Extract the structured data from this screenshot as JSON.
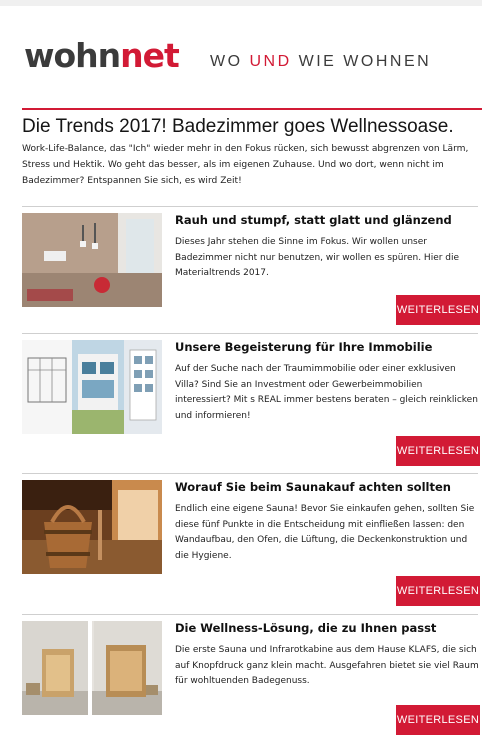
{
  "header": {
    "logo_part1": "wohn",
    "logo_part2": "net",
    "tagline_wo": "WO",
    "tagline_und": "UND",
    "tagline_wie": "WIE WOHNEN"
  },
  "headline": "Die Trends 2017! Badezimmer goes Wellnessoase.",
  "intro": "Work-Life-Balance, das \"Ich\" wieder mehr in den Fokus rücken, sich bewusst abgrenzen von Lärm, Stress und Hektik. Wo geht das besser, als im eigenen Zuhause. Und wo dort, wenn nicht im Badezimmer? Entspannen Sie sich, es wird Zeit!",
  "articles": [
    {
      "title": "Rauh und stumpf, statt glatt und glänzend",
      "text": "Dieses Jahr stehen die Sinne im Fokus. Wir wollen unser Badezimmer nicht nur benutzen, wir wollen es spüren. Hier die Materialtrends 2017.",
      "button": "WEITERLESEN",
      "image": "bathroom-image"
    },
    {
      "title": "Unsere Begeisterung für Ihre Immobilie",
      "text": "Auf der Suche nach der Traumimmobilie oder einer exklusiven Villa? Sind Sie an Investment oder Gewerbeimmobilien interessiert? Mit s REAL immer bestens beraten – gleich reinklicken und informieren!",
      "button": "WEITERLESEN",
      "image": "houses-image"
    },
    {
      "title": "Worauf Sie beim Saunakauf achten sollten",
      "text": "Endlich eine eigene Sauna! Bevor Sie einkaufen gehen, sollten Sie diese fünf Punkte in die Entscheidung mit einfließen lassen: den Wandaufbau, den Ofen, die Lüftung, die Deckenkonstruktion und die Hygiene.",
      "button": "WEITERLESEN",
      "image": "sauna-bucket-image"
    },
    {
      "title": "Die Wellness-Lösung, die zu Ihnen passt",
      "text": "Die erste Sauna und Infrarotkabine aus dem Hause KLAFS, die sich auf Knopfdruck ganz klein macht. Ausgefahren bietet sie viel Raum für wohltuenden Badegenuss.",
      "button": "WEITERLESEN",
      "image": "sauna-cabin-image"
    }
  ],
  "colors": {
    "brand_red": "#d21a35",
    "logo_gray": "#3b3b3b"
  }
}
